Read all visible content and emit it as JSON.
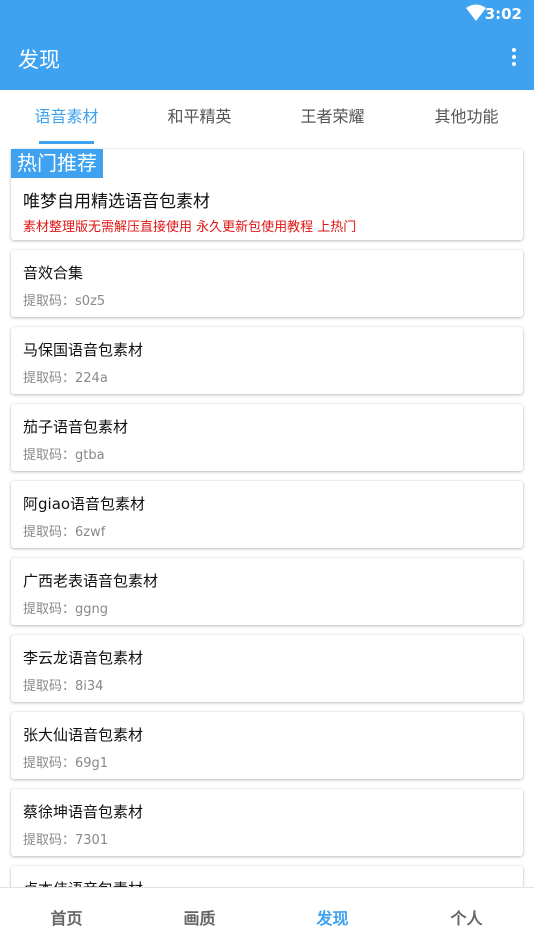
{
  "status": {
    "time": "3:02"
  },
  "app_bar": {
    "title": "发现"
  },
  "tabs": [
    {
      "label": "语音素材",
      "active": true
    },
    {
      "label": "和平精英",
      "active": false
    },
    {
      "label": "王者荣耀",
      "active": false
    },
    {
      "label": "其他功能",
      "active": false
    }
  ],
  "hot": {
    "badge": "热门推荐",
    "title": "唯梦自用精选语音包素材",
    "subtitle": "素材整理版无需解压直接使用 永久更新包使用教程 上热门"
  },
  "code_label": "提取码：",
  "items": [
    {
      "name": "音效合集",
      "code": "s0z5"
    },
    {
      "name": "马保国语音包素材",
      "code": "224a"
    },
    {
      "name": "茄子语音包素材",
      "code": "gtba"
    },
    {
      "name": "阿giao语音包素材",
      "code": "6zwf"
    },
    {
      "name": "广西老表语音包素材",
      "code": "ggng"
    },
    {
      "name": "李云龙语音包素材",
      "code": "8i34"
    },
    {
      "name": "张大仙语音包素材",
      "code": "69g1"
    },
    {
      "name": "蔡徐坤语音包素材",
      "code": "7301"
    },
    {
      "name": "卢本伟语音包素材",
      "code": ""
    }
  ],
  "bottom_nav": [
    {
      "label": "首页"
    },
    {
      "label": "画质"
    },
    {
      "label": "发现"
    },
    {
      "label": "个人"
    }
  ],
  "colors": {
    "primary": "#3ea2f0",
    "hot_text": "#e01515"
  }
}
